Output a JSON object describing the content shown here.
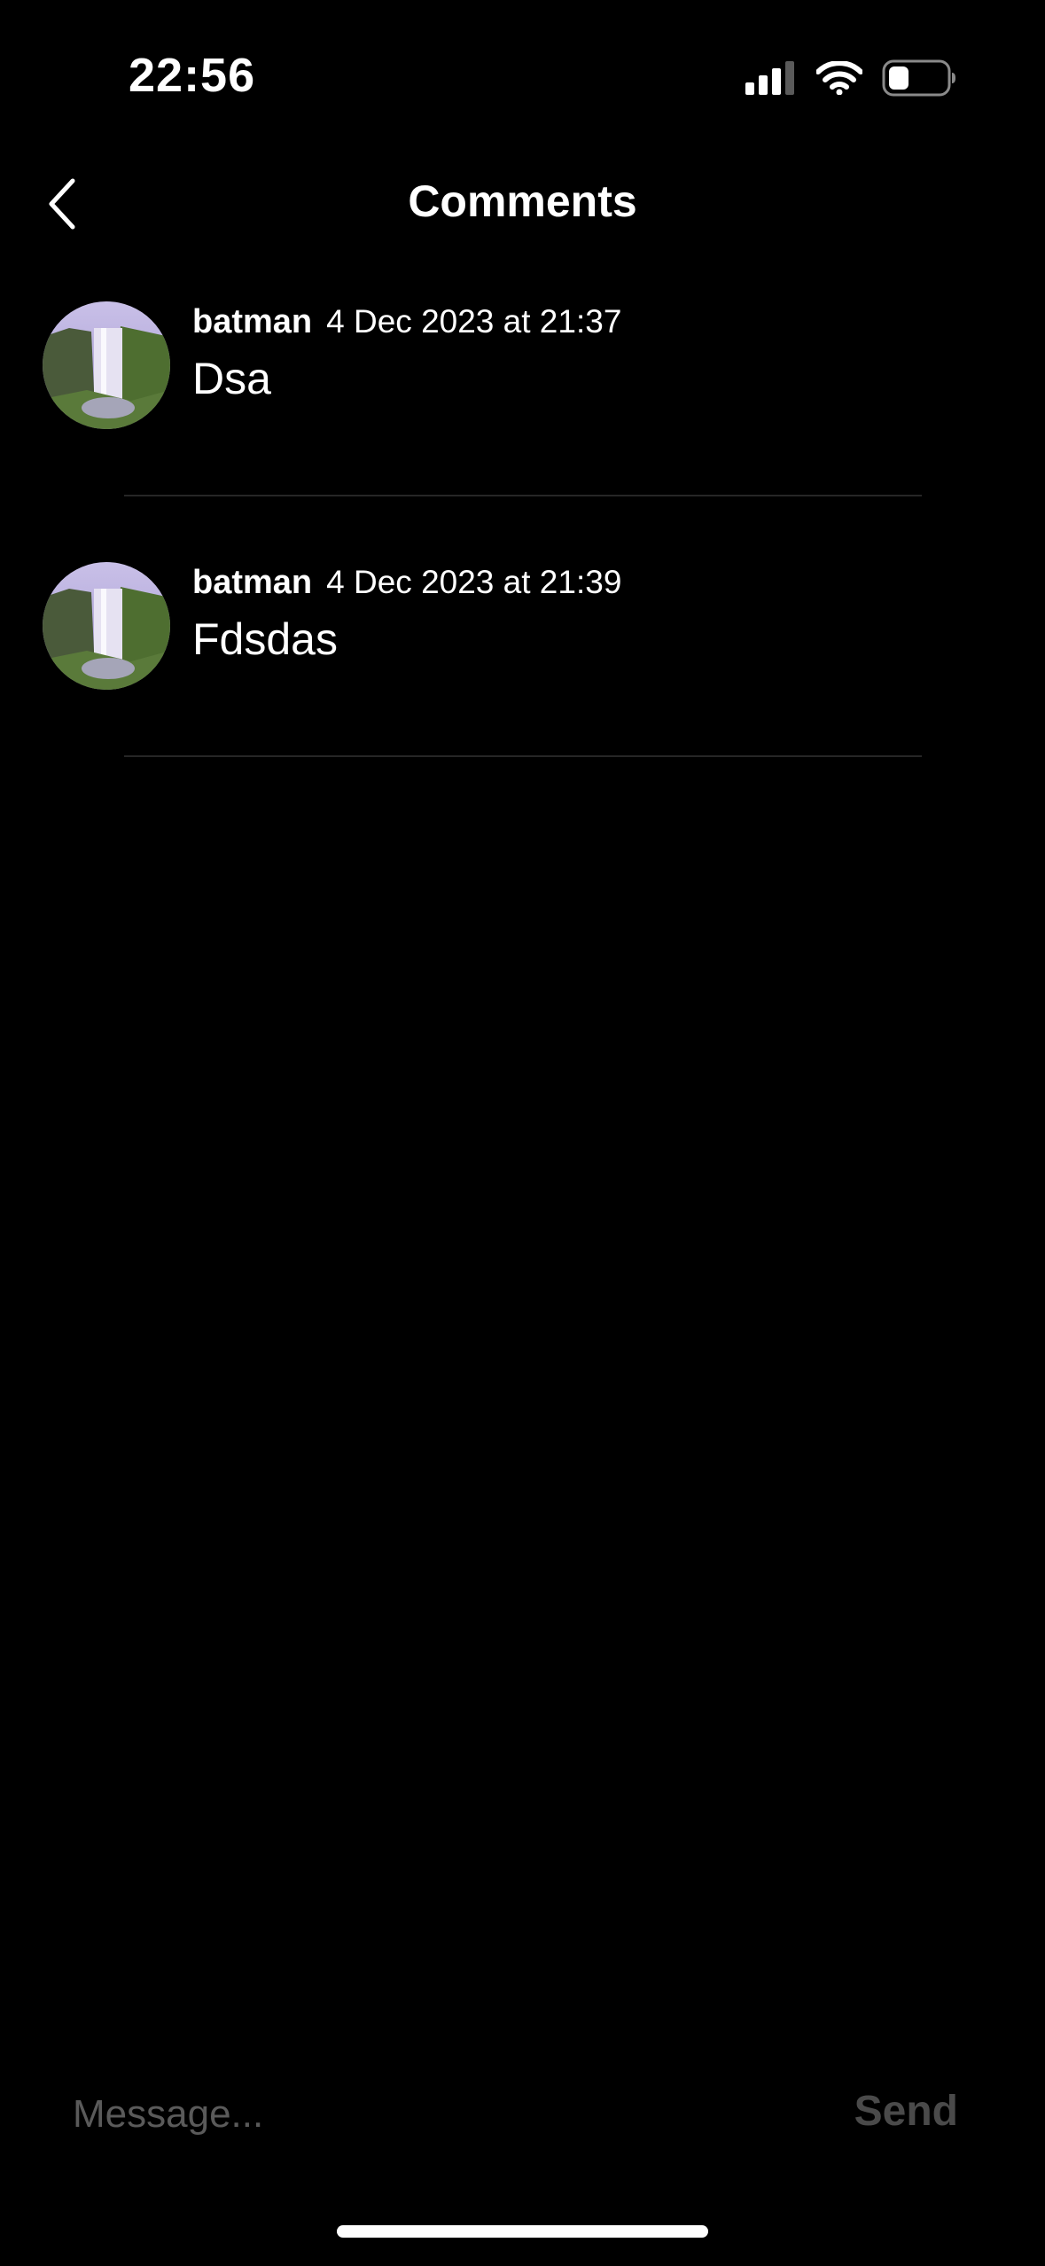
{
  "status_bar": {
    "time": "22:56",
    "icons": [
      "cellular-signal-icon",
      "wifi-icon",
      "battery-icon"
    ]
  },
  "nav": {
    "title": "Comments",
    "back_icon": "chevron-left-icon"
  },
  "comments": [
    {
      "username": "batman",
      "timestamp": "4 Dec 2023 at 21:37",
      "text": "Dsa",
      "avatar": "waterfall-avatar"
    },
    {
      "username": "batman",
      "timestamp": "4 Dec 2023 at 21:39",
      "text": "Fdsdas",
      "avatar": "waterfall-avatar"
    }
  ],
  "composer": {
    "placeholder": "Message...",
    "value": "",
    "send_label": "Send"
  },
  "colors": {
    "background": "#000000",
    "text": "#ffffff",
    "placeholder": "#5a5a5a",
    "send_disabled": "#4a4a4a",
    "divider": "#262626"
  }
}
